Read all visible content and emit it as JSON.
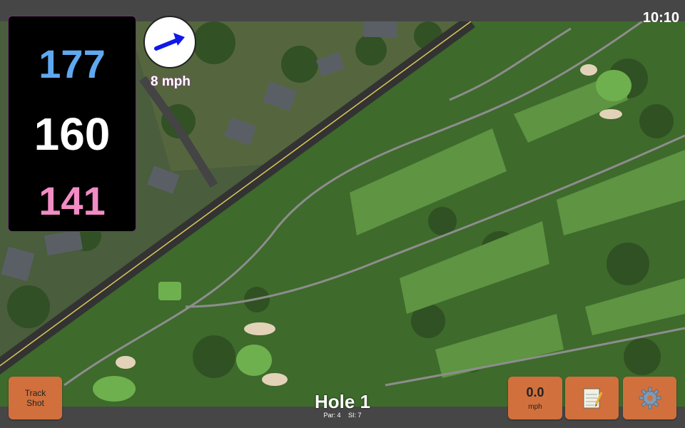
{
  "status": {
    "clock": "10:10"
  },
  "yardage": {
    "back": "177",
    "middle": "160",
    "front": "141"
  },
  "wind": {
    "speed_label": "8 mph",
    "icon": "wind-arrow-icon"
  },
  "hole": {
    "title": "Hole 1",
    "par": "Par: 4",
    "si": "SI: 7"
  },
  "buttons": {
    "track_shot_line1": "Track",
    "track_shot_line2": "Shot",
    "speed_value": "0.0",
    "speed_unit": "mph",
    "notes_icon": "notepad-icon",
    "settings_icon": "gear-icon"
  },
  "colors": {
    "back_yardage": "#5fa8f0",
    "middle_yardage": "#ffffff",
    "front_yardage": "#f28cc4",
    "button_orange": "#d1703c",
    "wind_arrow": "#1018e8"
  }
}
